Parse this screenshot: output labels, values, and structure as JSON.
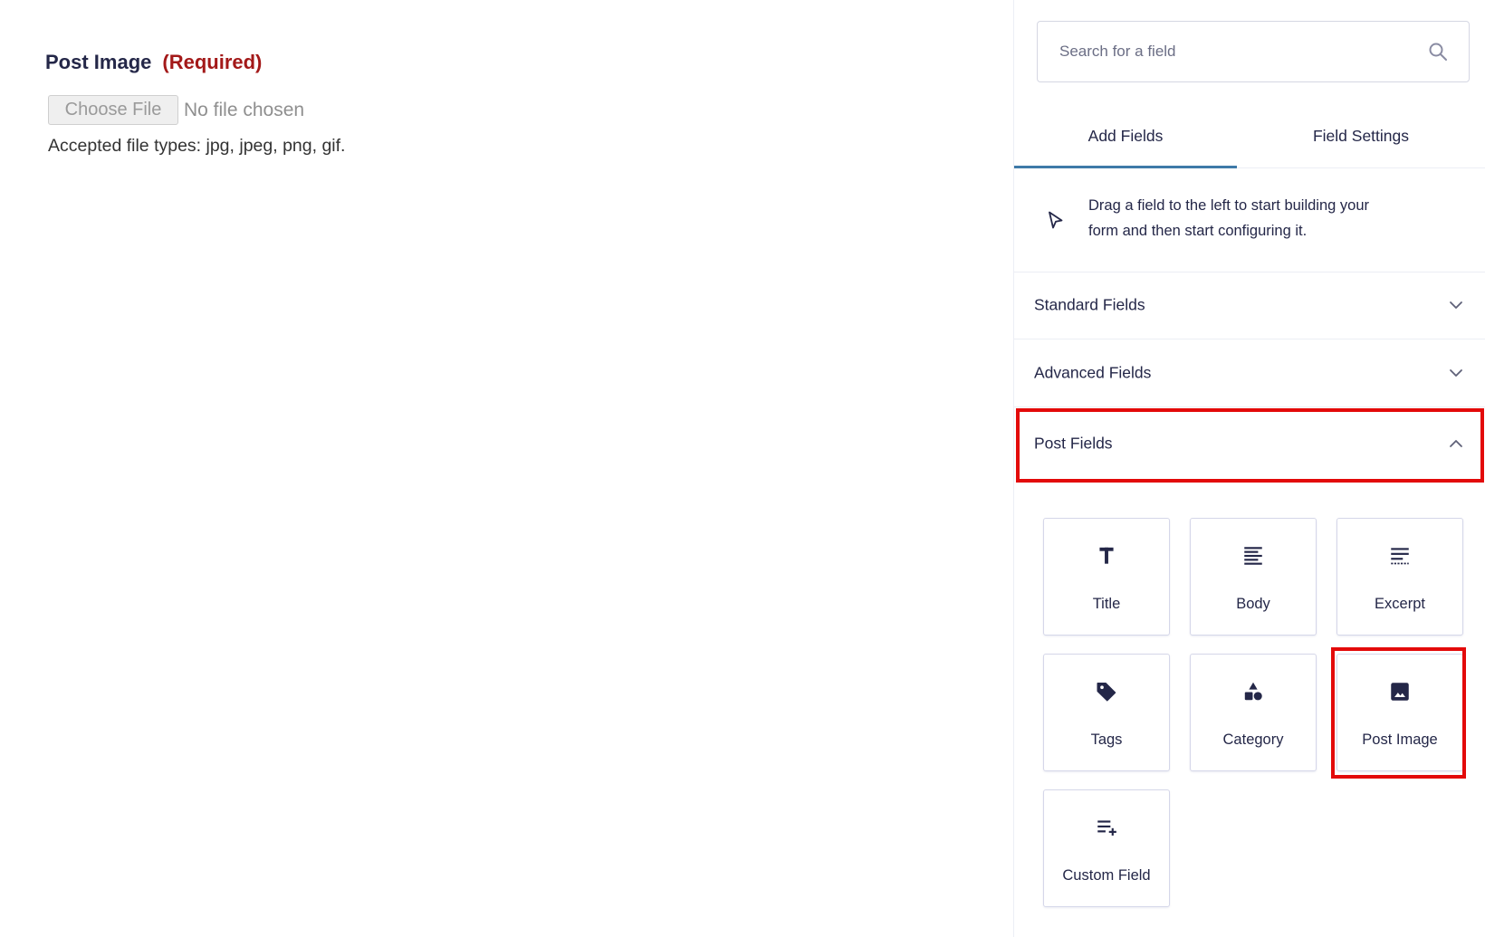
{
  "form_preview": {
    "field_label": "Post Image",
    "required_label": "(Required)",
    "file_button_label": "Choose File",
    "file_status": "No file chosen",
    "accepted_types": "Accepted file types: jpg, jpeg, png, gif."
  },
  "sidebar": {
    "search": {
      "placeholder": "Search for a field",
      "value": "",
      "icon": "search-icon"
    },
    "tabs": [
      {
        "label": "Add Fields",
        "active": true
      },
      {
        "label": "Field Settings",
        "active": false
      }
    ],
    "hint": {
      "icon": "cursor-icon",
      "lines": [
        "Drag a field to the left to start building your",
        "form and then start configuring it."
      ]
    },
    "sections": [
      {
        "label": "Standard Fields",
        "expanded": false,
        "icon": "chevron-down-icon",
        "highlighted": false
      },
      {
        "label": "Advanced Fields",
        "expanded": false,
        "icon": "chevron-down-icon",
        "highlighted": false
      },
      {
        "label": "Post Fields",
        "expanded": true,
        "icon": "chevron-up-icon",
        "highlighted": true,
        "items": [
          {
            "label": "Title",
            "icon": "title-icon",
            "highlighted": false
          },
          {
            "label": "Body",
            "icon": "body-icon",
            "highlighted": false
          },
          {
            "label": "Excerpt",
            "icon": "excerpt-icon",
            "highlighted": false
          },
          {
            "label": "Tags",
            "icon": "tag-icon",
            "highlighted": false
          },
          {
            "label": "Category",
            "icon": "category-icon",
            "highlighted": false
          },
          {
            "label": "Post Image",
            "icon": "image-icon",
            "highlighted": true
          },
          {
            "label": "Custom Field",
            "icon": "custom-field-icon",
            "highlighted": false
          }
        ]
      }
    ]
  },
  "colors": {
    "text": "#242748",
    "required": "#a31919",
    "accent": "#3e7aa8",
    "highlight": "#e30a0a"
  }
}
